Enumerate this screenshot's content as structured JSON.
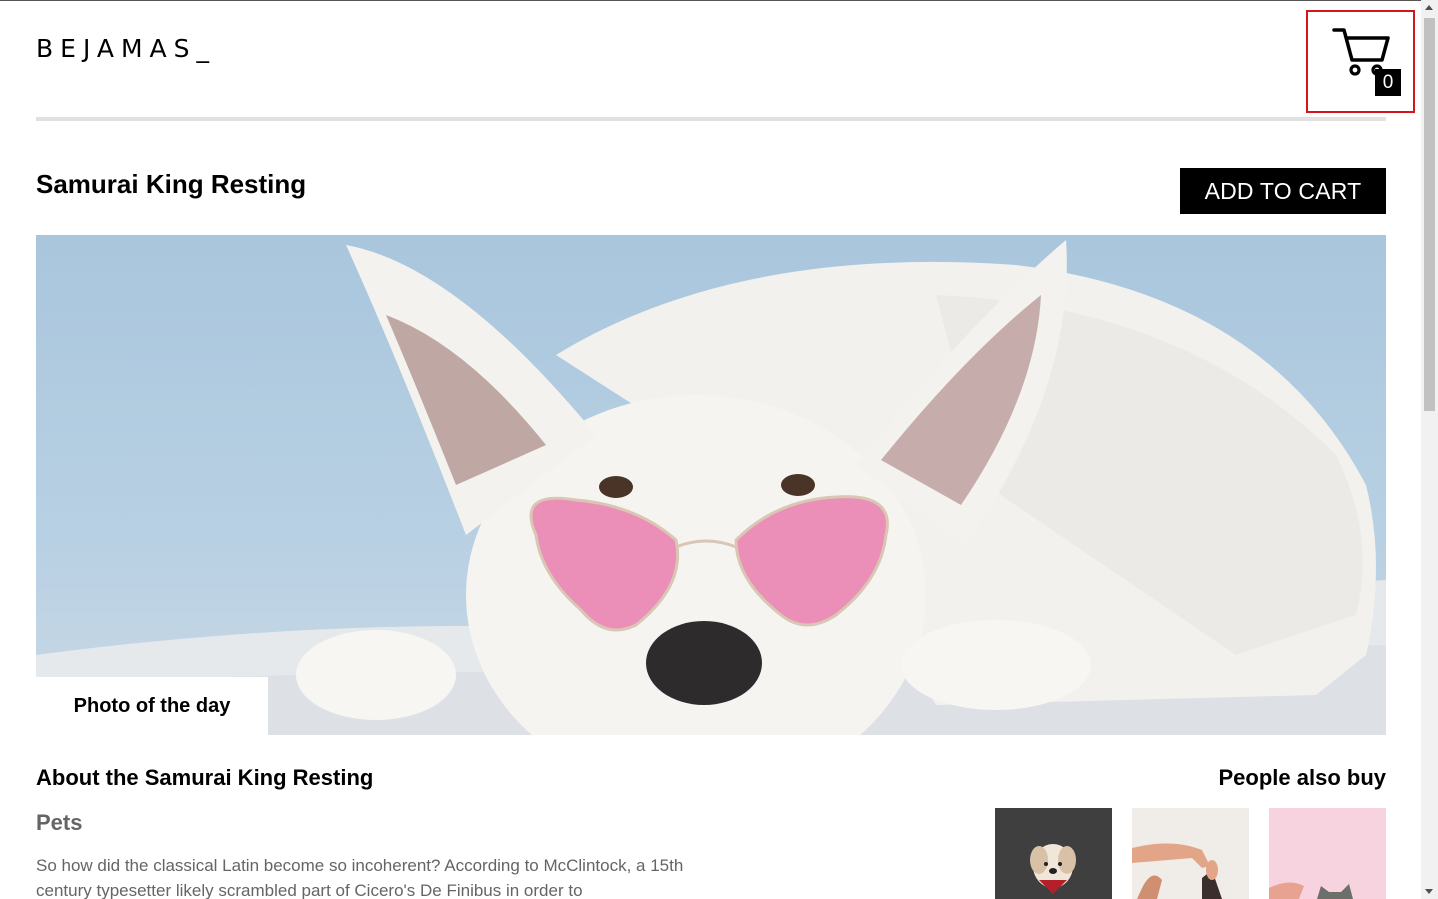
{
  "header": {
    "logo": "BEJAMAS_",
    "cart_count": "0"
  },
  "product": {
    "title": "Samurai King Resting",
    "add_to_cart_label": "ADD TO CART",
    "photo_label": "Photo of the day"
  },
  "about": {
    "title": "About the Samurai King Resting",
    "category": "Pets",
    "description": "So how did the classical Latin become so incoherent? According to McClintock, a 15th century typesetter likely scrambled part of Cicero's De Finibus in order to"
  },
  "also_buy": {
    "title": "People also buy"
  },
  "icons": {
    "cart": "shopping-cart-icon"
  },
  "colors": {
    "cart_highlight_border": "#d3161c",
    "button_bg": "#000000",
    "muted_text": "#656565"
  }
}
